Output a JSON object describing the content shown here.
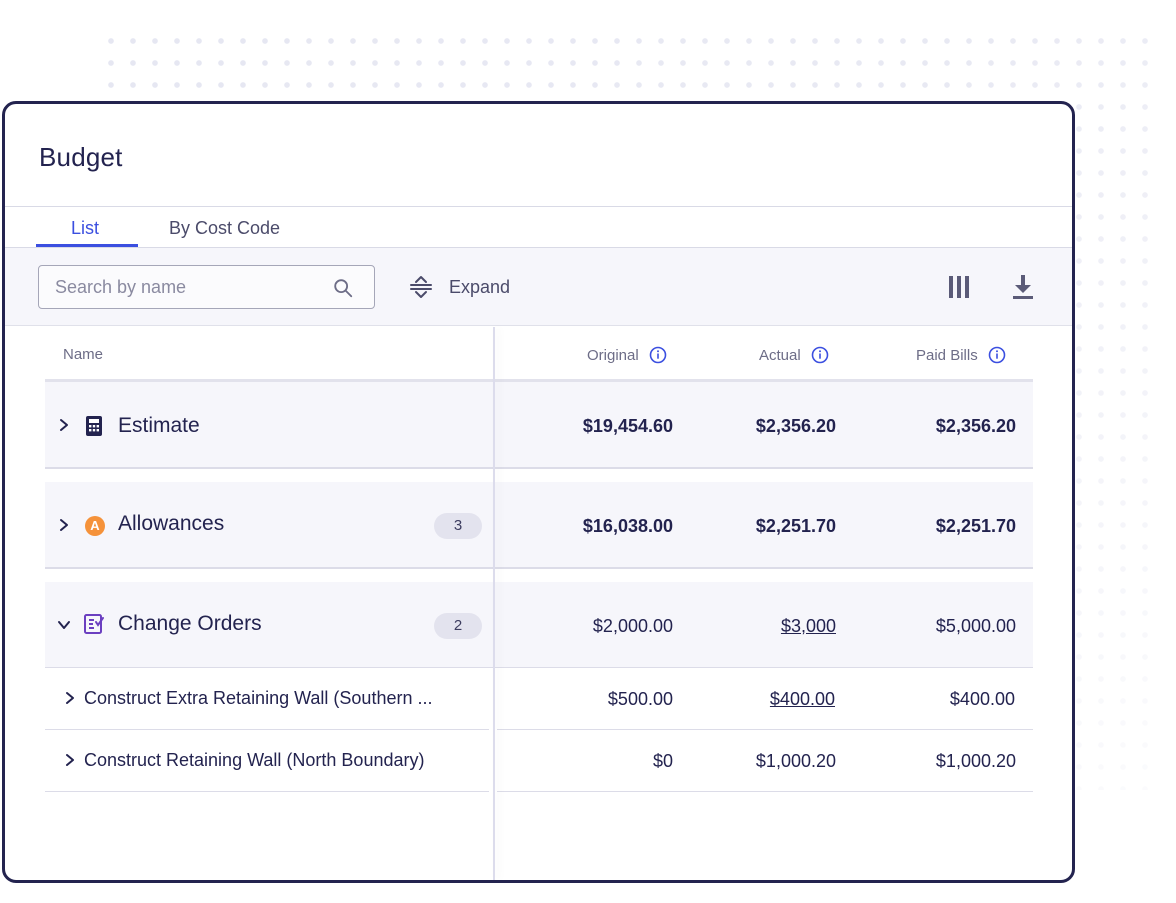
{
  "title": "Budget",
  "tabs": [
    {
      "label": "List",
      "active": true
    },
    {
      "label": "By Cost Code",
      "active": false
    }
  ],
  "toolbar": {
    "search_placeholder": "Search by name",
    "expand_label": "Expand"
  },
  "columns": {
    "name": "Name",
    "original": "Original",
    "actual": "Actual",
    "paid_bills": "Paid Bills"
  },
  "rows": [
    {
      "name": "Estimate",
      "icon": "calculator-icon",
      "expanded": false,
      "original": "$19,454.60",
      "actual": "$2,356.20",
      "paid_bills": "$2,356.20"
    },
    {
      "name": "Allowances",
      "icon": "allowance-icon",
      "icon_letter": "A",
      "expanded": false,
      "count": "3",
      "original": "$16,038.00",
      "actual": "$2,251.70",
      "paid_bills": "$2,251.70"
    },
    {
      "name": "Change Orders",
      "icon": "change-order-icon",
      "expanded": true,
      "count": "2",
      "original": "$2,000.00",
      "actual": "$3,000",
      "paid_bills": "$5,000.00"
    }
  ],
  "sub_rows": [
    {
      "name": "Construct Extra Retaining Wall (Southern ...",
      "original": "$500.00",
      "actual": "$400.00",
      "paid_bills": "$400.00"
    },
    {
      "name": "Construct Retaining Wall (North Boundary)",
      "original": "$0",
      "actual": "$1,000.20",
      "paid_bills": "$1,000.20"
    }
  ],
  "colors": {
    "accent": "#3b4fe0",
    "navy": "#23234f",
    "allowance_orange": "#f5923a",
    "change_order_purple": "#6b3fc0"
  }
}
